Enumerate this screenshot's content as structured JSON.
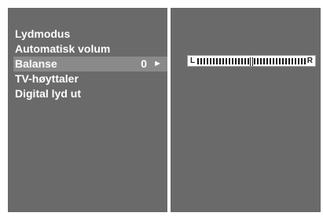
{
  "menu": {
    "items": [
      {
        "label": "Lydmodus"
      },
      {
        "label": "Automatisk volum"
      },
      {
        "label": "Balanse",
        "value": "0",
        "arrow": "►"
      },
      {
        "label": "TV-høyttaler"
      },
      {
        "label": "Digital lyd ut"
      }
    ],
    "selected_index": 2
  },
  "balance": {
    "left_label": "L",
    "right_label": "R",
    "level": 0
  },
  "colors": {
    "panel": "#6a6a6a",
    "highlight": "#8a8a8a",
    "text": "#ffffff"
  }
}
